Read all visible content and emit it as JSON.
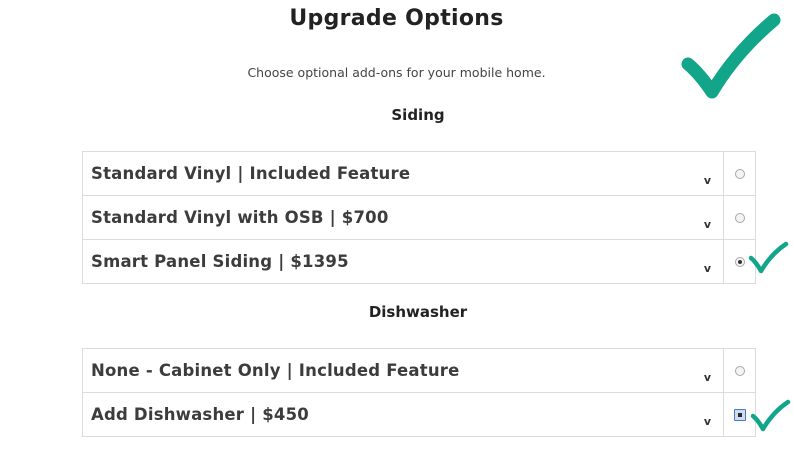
{
  "header": {
    "title": "Upgrade Options",
    "subtitle": "Choose optional add-ons for your mobile home."
  },
  "accent_color": "#12A58A",
  "sections": [
    {
      "title": "Siding",
      "options": [
        {
          "label": "Standard Vinyl | Included Feature",
          "selected": false,
          "control": "radio",
          "chevron": "v"
        },
        {
          "label": "Standard Vinyl with OSB | $700",
          "selected": false,
          "control": "radio",
          "chevron": "v"
        },
        {
          "label": "Smart Panel Siding | $1395",
          "selected": true,
          "control": "radio",
          "chevron": "v"
        }
      ]
    },
    {
      "title": "Dishwasher",
      "options": [
        {
          "label": "None - Cabinet Only | Included Feature",
          "selected": false,
          "control": "radio",
          "chevron": "v"
        },
        {
          "label": "Add Dishwasher | $450",
          "selected": true,
          "control": "checkbox",
          "chevron": "v"
        }
      ]
    }
  ]
}
